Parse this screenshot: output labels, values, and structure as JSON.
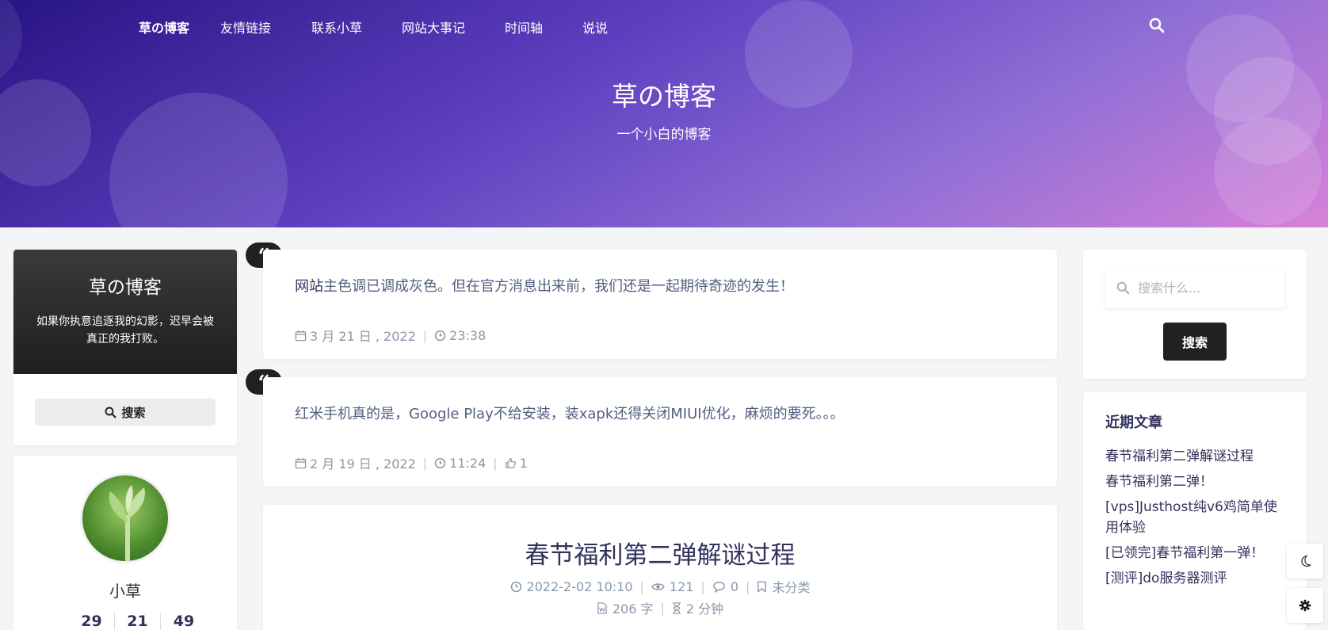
{
  "nav": {
    "brand": "草の博客",
    "items": [
      "友情链接",
      "联系小草",
      "网站大事记",
      "时间轴",
      "说说"
    ]
  },
  "hero": {
    "title": "草の博客",
    "subtitle": "一个小白的博客"
  },
  "left_card": {
    "title": "草の博客",
    "desc": "如果你执意追逐我的幻影，迟早会被真正的我打败。",
    "search_label": "搜索"
  },
  "profile": {
    "name": "小草",
    "stats": [
      "29",
      "21",
      "49"
    ]
  },
  "posts": [
    {
      "text_highlight": "网站",
      "text_rest": "主色调已调成灰色。但在官方消息出来前，我们还是一起期待奇迹的发生！",
      "date": "3 月 21 日 , 2022",
      "time": "23:38"
    },
    {
      "text_highlight": "",
      "text_rest": "红米手机真的是，Google Play不给安装，装xapk还得关闭MIUI优化，麻烦的要死。。。",
      "date": "2 月 19 日 , 2022",
      "time": "11:24",
      "likes": "1"
    }
  ],
  "article": {
    "title": "春节福利第二弹解谜过程",
    "datetime": "2022-2-02 10:10",
    "views": "121",
    "comments": "0",
    "category": "未分类",
    "words": "206 字",
    "read_time": "2 分钟"
  },
  "right_search": {
    "placeholder": "搜索什么...",
    "button": "搜索"
  },
  "recent": {
    "title": "近期文章",
    "items": [
      "春节福利第二弹解谜过程",
      "春节福利第二弹！",
      "[vps]Justhost纯v6鸡简单使用体验",
      "[已领完]春节福利第一弹！",
      "[测评]do服务器测评"
    ]
  },
  "colors": {
    "banner_start": "#281483",
    "banner_end": "#d782d9",
    "dark": "#212121"
  }
}
